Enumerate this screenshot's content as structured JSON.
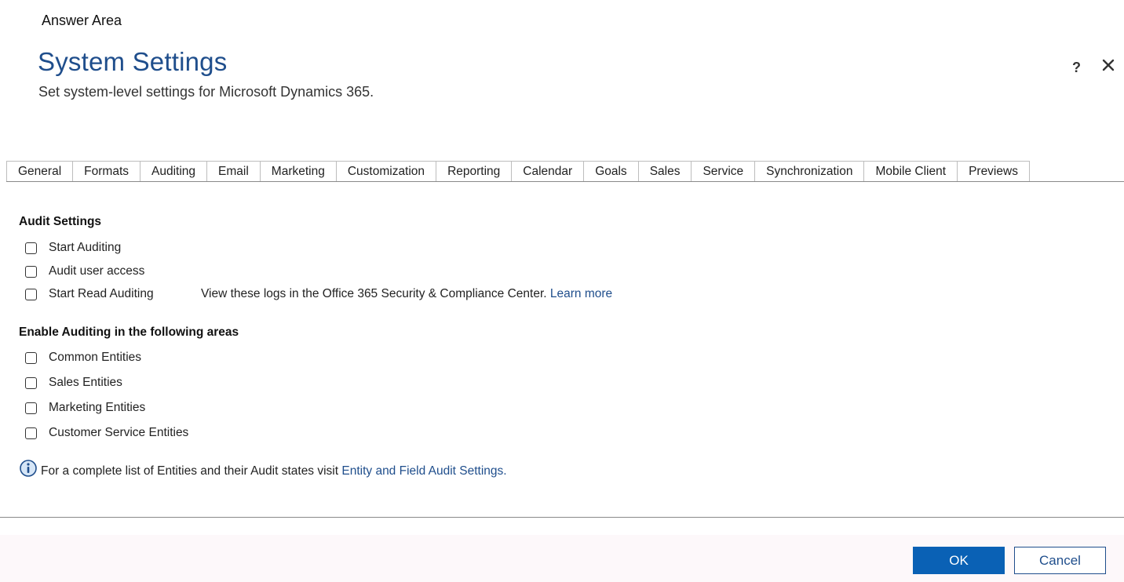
{
  "answer_area_label": "Answer Area",
  "header": {
    "title": "System Settings",
    "subtitle": "Set system-level settings for Microsoft Dynamics 365.",
    "help_icon": "?",
    "close_icon": "close-icon"
  },
  "tabs": [
    {
      "label": "General"
    },
    {
      "label": "Formats"
    },
    {
      "label": "Auditing"
    },
    {
      "label": "Email"
    },
    {
      "label": "Marketing"
    },
    {
      "label": "Customization"
    },
    {
      "label": "Reporting"
    },
    {
      "label": "Calendar"
    },
    {
      "label": "Goals"
    },
    {
      "label": "Sales"
    },
    {
      "label": "Service"
    },
    {
      "label": "Synchronization"
    },
    {
      "label": "Mobile Client"
    },
    {
      "label": "Previews"
    }
  ],
  "audit_settings": {
    "heading": "Audit Settings",
    "options": [
      {
        "label": "Start Auditing",
        "checked": false
      },
      {
        "label": "Audit user access",
        "checked": false
      },
      {
        "label": "Start Read Auditing",
        "checked": false
      }
    ],
    "read_note": "View these logs in the Office 365 Security & Compliance Center.",
    "read_link": "Learn more"
  },
  "enable_areas": {
    "heading": "Enable Auditing in the following areas",
    "options": [
      {
        "label": "Common Entities",
        "checked": false
      },
      {
        "label": "Sales Entities",
        "checked": false
      },
      {
        "label": "Marketing Entities",
        "checked": false
      },
      {
        "label": "Customer Service Entities",
        "checked": false
      }
    ]
  },
  "info": {
    "icon": "info-icon",
    "text": "For a complete list of Entities and their Audit states visit",
    "link": "Entity and Field Audit Settings."
  },
  "footer": {
    "ok_label": "OK",
    "cancel_label": "Cancel"
  },
  "colors": {
    "title": "#1f4e8c",
    "ok_button": "#0a61b5",
    "link": "#1f4e8c"
  }
}
